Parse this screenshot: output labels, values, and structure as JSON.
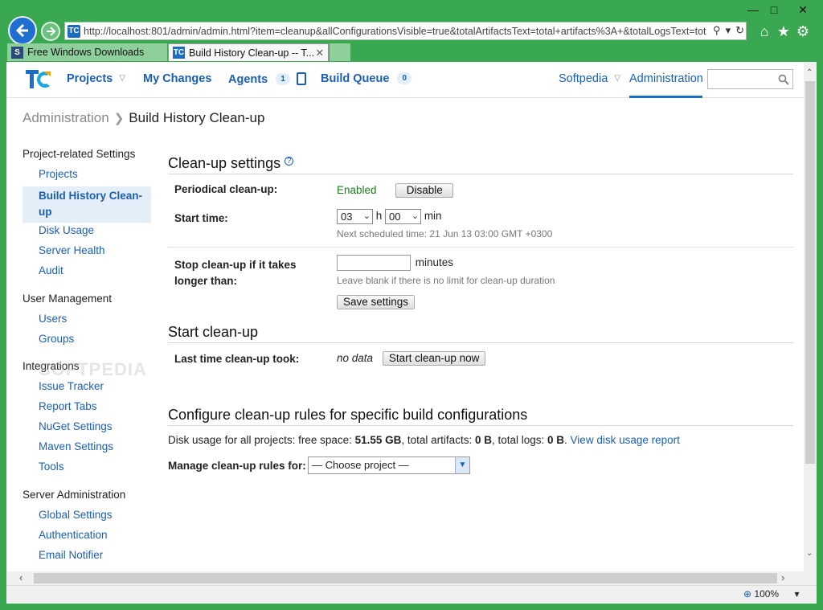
{
  "browser": {
    "url": "http://localhost:801/admin/admin.html?item=cleanup&allConfigurationsVisible=true&totalArtifactsText=total+artifacts%3A+&totalLogsText=tot",
    "tabs": [
      {
        "label": "Free Windows Downloads"
      },
      {
        "label": "Build History Clean-up -- T..."
      }
    ],
    "zoom": "100%"
  },
  "topnav": {
    "projects": "Projects",
    "my_changes": "My Changes",
    "agents": "Agents",
    "agents_count": "1",
    "build_queue": "Build Queue",
    "queue_count": "0",
    "user": "Softpedia",
    "administration": "Administration"
  },
  "breadcrumb": {
    "parent": "Administration",
    "current": "Build History Clean-up"
  },
  "sidebar": {
    "groups": [
      {
        "title": "Project-related Settings",
        "items": [
          "Projects",
          "Build History Clean-up",
          "Disk Usage",
          "Server Health",
          "Audit"
        ]
      },
      {
        "title": "User Management",
        "items": [
          "Users",
          "Groups"
        ]
      },
      {
        "title": "Integrations",
        "items": [
          "Issue Tracker",
          "Report Tabs",
          "NuGet Settings",
          "Maven Settings",
          "Tools"
        ]
      },
      {
        "title": "Server Administration",
        "items": [
          "Global Settings",
          "Authentication",
          "Email Notifier"
        ]
      }
    ]
  },
  "cleanup_settings": {
    "title": "Clean-up settings",
    "help": "?",
    "periodical_label": "Periodical clean-up:",
    "status": "Enabled",
    "disable_label": "Disable",
    "start_time_label": "Start time:",
    "hour": "03",
    "h": "h",
    "minute": "00",
    "min": "min",
    "next_scheduled": "Next scheduled time: 21 Jun 13 03:00 GMT +0300",
    "stop_label_1": "Stop clean-up if it takes",
    "stop_label_2": "longer than:",
    "minutes_value": "",
    "minutes": "minutes",
    "stop_hint": "Leave blank if there is no limit for clean-up duration",
    "save_label": "Save settings"
  },
  "start_cleanup": {
    "title": "Start clean-up",
    "last_label": "Last time clean-up took:",
    "last_value": "no data",
    "start_label": "Start clean-up now"
  },
  "rules": {
    "title": "Configure clean-up rules for specific build configurations",
    "disk_prefix": "Disk usage for all projects: free space: ",
    "free_space": "51.55 GB",
    "artifacts_prefix": ", total artifacts: ",
    "artifacts": "0 B",
    "logs_prefix": ", total logs: ",
    "logs": "0 B",
    "period": ". ",
    "report_link": "View disk usage report",
    "manage_label": "Manage clean-up rules for:",
    "project_select": "— Choose project —"
  },
  "watermark": "SOFTPEDIA"
}
